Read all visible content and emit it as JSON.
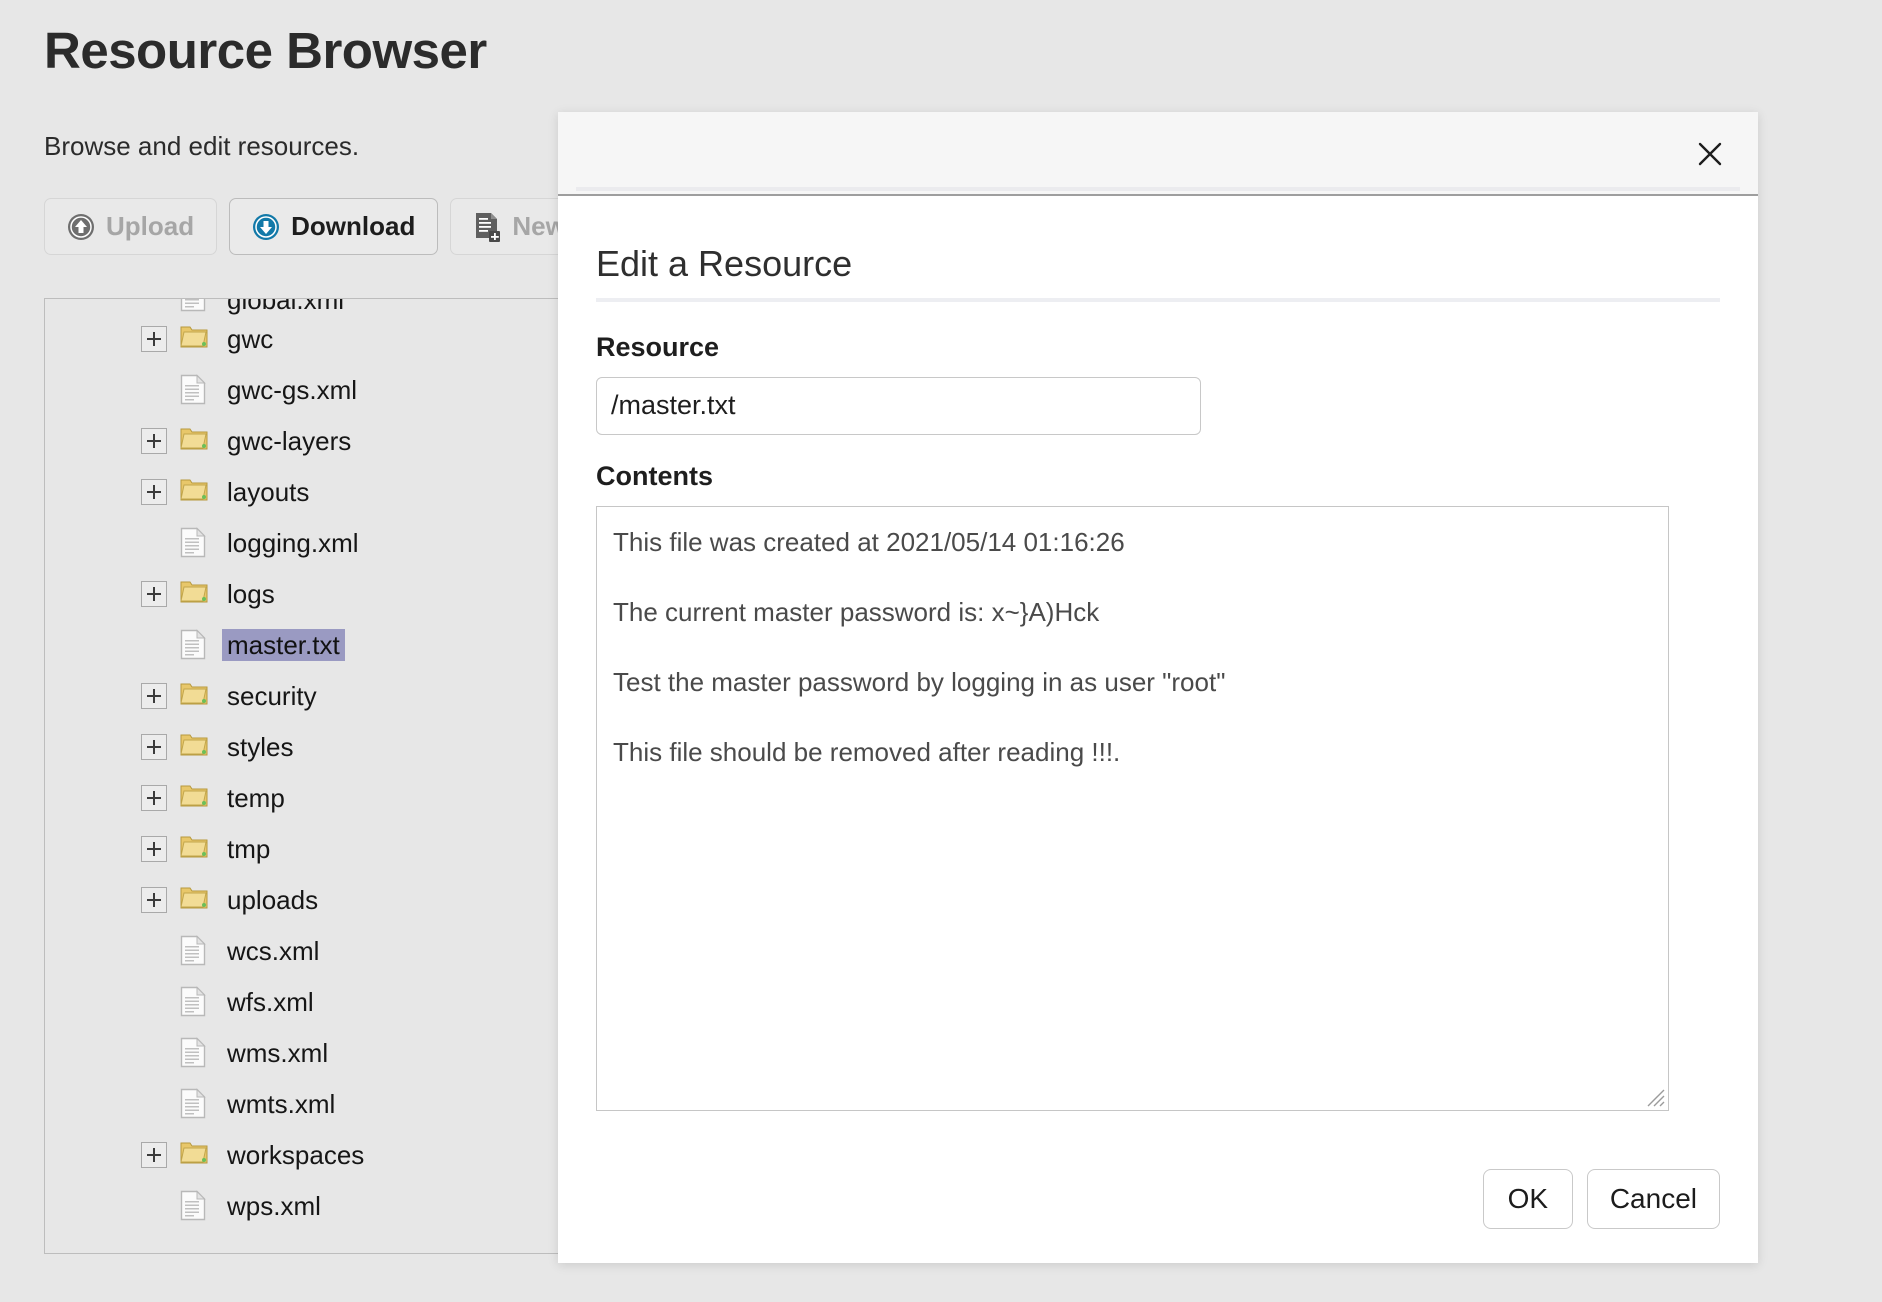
{
  "page": {
    "title": "Resource Browser",
    "subtitle": "Browse and edit resources."
  },
  "toolbar": {
    "buttons": [
      {
        "label": "Upload",
        "icon": "circle-up-arrow-icon",
        "enabled": false,
        "icon_color": "#6e6e6e"
      },
      {
        "label": "Download",
        "icon": "circle-down-arrow-icon",
        "enabled": true,
        "icon_color": "#1279a8"
      },
      {
        "label": "New",
        "icon": "new-file-icon",
        "enabled": false,
        "icon_color": "#6e6e6e"
      }
    ]
  },
  "tree": {
    "selected": "master.txt",
    "selection_color": "#9a9ac2",
    "nodes": [
      {
        "label": "global.xml",
        "type": "file",
        "expandable": false,
        "clipped": true
      },
      {
        "label": "gwc",
        "type": "folder",
        "expandable": true
      },
      {
        "label": "gwc-gs.xml",
        "type": "file",
        "expandable": false
      },
      {
        "label": "gwc-layers",
        "type": "folder",
        "expandable": true
      },
      {
        "label": "layouts",
        "type": "folder",
        "expandable": true
      },
      {
        "label": "logging.xml",
        "type": "file",
        "expandable": false
      },
      {
        "label": "logs",
        "type": "folder",
        "expandable": true
      },
      {
        "label": "master.txt",
        "type": "file",
        "expandable": false,
        "selected": true
      },
      {
        "label": "security",
        "type": "folder",
        "expandable": true
      },
      {
        "label": "styles",
        "type": "folder",
        "expandable": true
      },
      {
        "label": "temp",
        "type": "folder",
        "expandable": true
      },
      {
        "label": "tmp",
        "type": "folder",
        "expandable": true
      },
      {
        "label": "uploads",
        "type": "folder",
        "expandable": true
      },
      {
        "label": "wcs.xml",
        "type": "file",
        "expandable": false
      },
      {
        "label": "wfs.xml",
        "type": "file",
        "expandable": false
      },
      {
        "label": "wms.xml",
        "type": "file",
        "expandable": false
      },
      {
        "label": "wmts.xml",
        "type": "file",
        "expandable": false
      },
      {
        "label": "workspaces",
        "type": "folder",
        "expandable": true
      },
      {
        "label": "wps.xml",
        "type": "file",
        "expandable": false
      }
    ]
  },
  "dialog": {
    "close_label": "×",
    "heading": "Edit a Resource",
    "resource": {
      "label": "Resource",
      "value": "/master.txt",
      "placeholder": ""
    },
    "contents": {
      "label": "Contents",
      "value": "This file was created at 2021/05/14 01:16:26\n\nThe current master password is: x~}A)Hck\n\nTest the master password by logging in as user \"root\"\n\nThis file should be removed after reading !!!.",
      "placeholder": ""
    },
    "ok_label": "OK",
    "cancel_label": "Cancel"
  }
}
